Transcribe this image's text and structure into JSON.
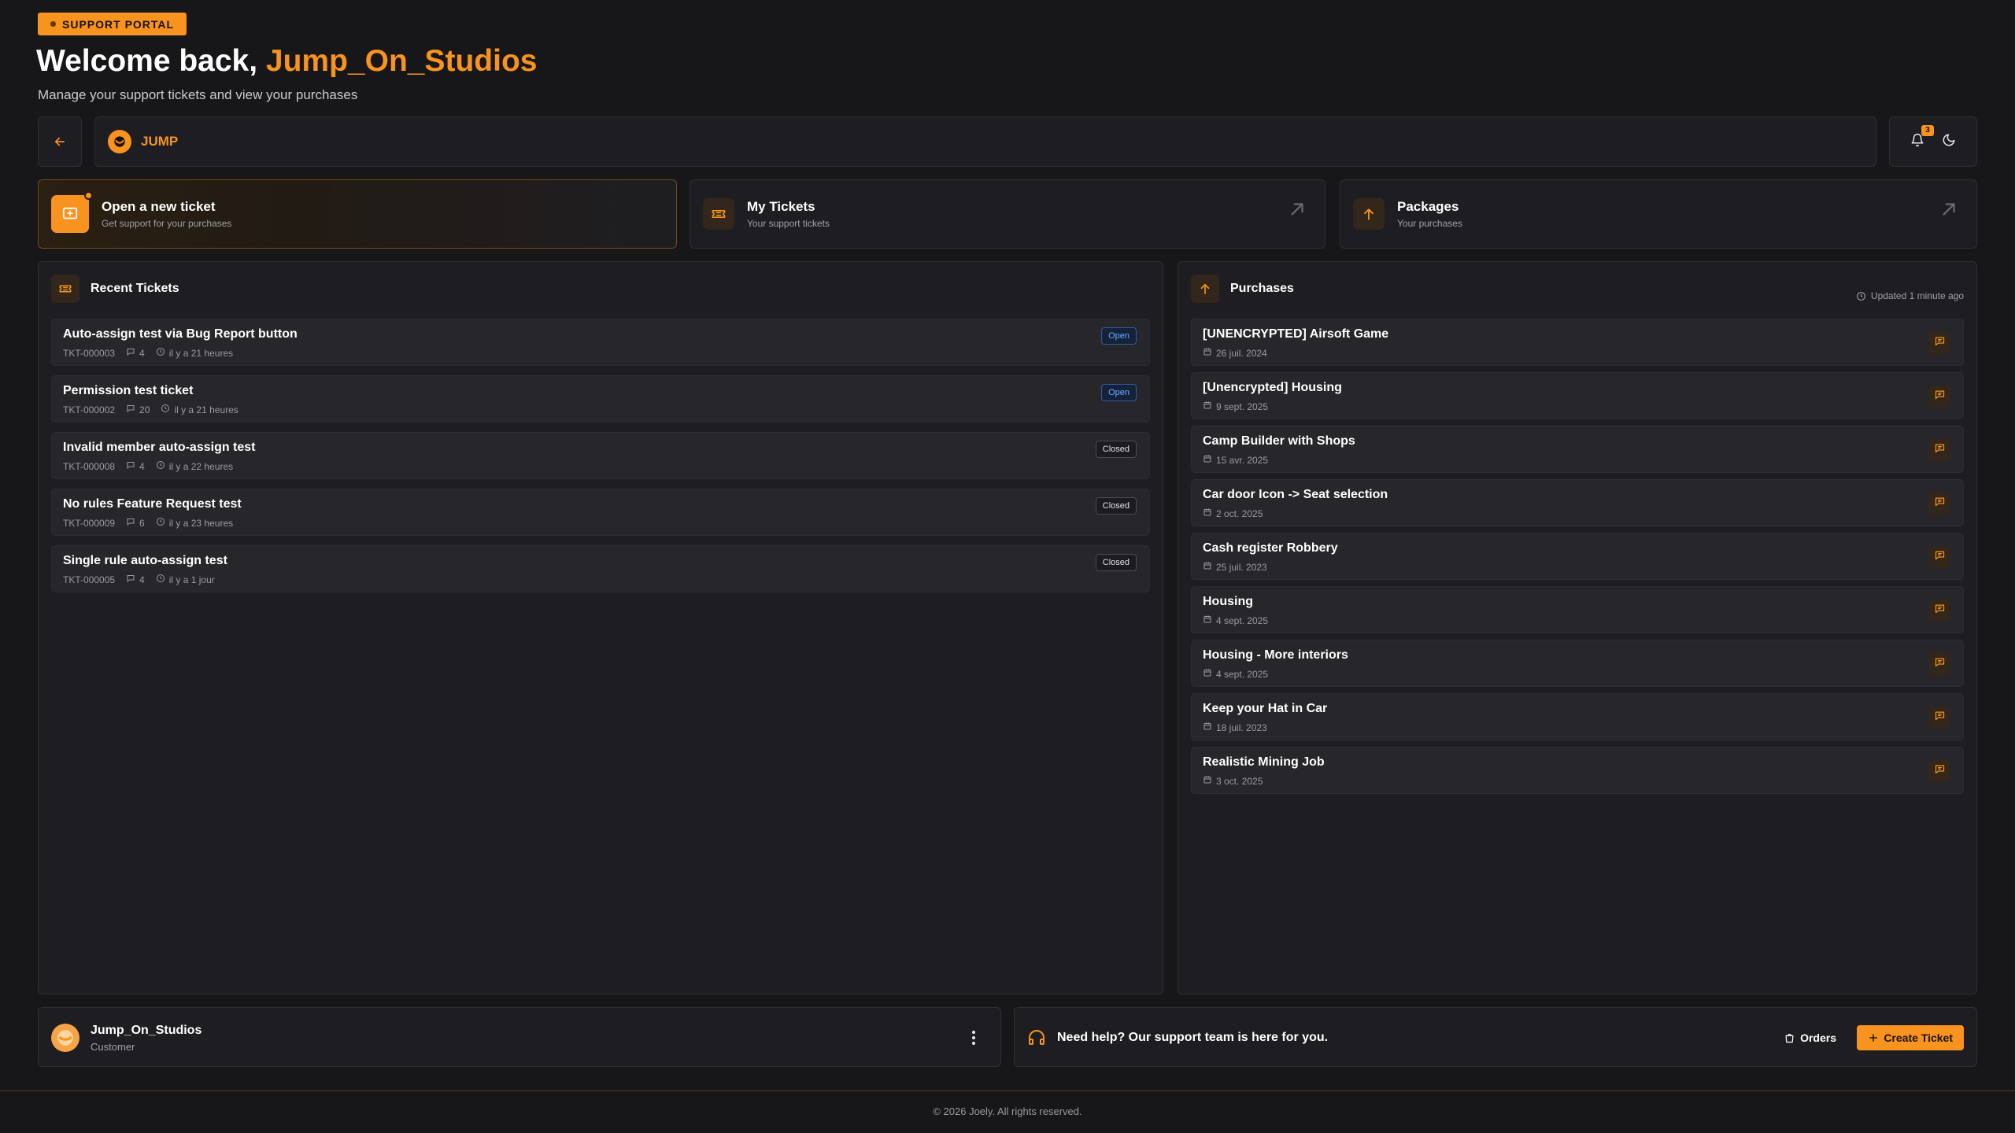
{
  "header": {
    "badge": "SUPPORT PORTAL",
    "welcome_prefix": "Welcome back,",
    "user_name": "Jump_On_Studios",
    "subtitle": "Manage your support tickets and view your purchases"
  },
  "brand": {
    "name": "JUMP"
  },
  "notifications": {
    "count": "3"
  },
  "quick_cards": [
    {
      "title": "Open a new ticket",
      "subtitle": "Get support for your purchases",
      "icon": "message-plus-icon"
    },
    {
      "title": "My Tickets",
      "subtitle": "Your support tickets",
      "icon": "ticket-icon"
    },
    {
      "title": "Packages",
      "subtitle": "Your purchases",
      "icon": "arrow-up-icon"
    }
  ],
  "tickets": {
    "title": "Recent Tickets",
    "items": [
      {
        "title": "Auto-assign test via Bug Report button",
        "id": "TKT-000003",
        "comments": "4",
        "time": "il y a 21 heures",
        "status": "Open"
      },
      {
        "title": "Permission test ticket",
        "id": "TKT-000002",
        "comments": "20",
        "time": "il y a 21 heures",
        "status": "Open"
      },
      {
        "title": "Invalid member auto-assign test",
        "id": "TKT-000008",
        "comments": "4",
        "time": "il y a 22 heures",
        "status": "Closed"
      },
      {
        "title": "No rules Feature Request test",
        "id": "TKT-000009",
        "comments": "6",
        "time": "il y a 23 heures",
        "status": "Closed"
      },
      {
        "title": "Single rule auto-assign test",
        "id": "TKT-000005",
        "comments": "4",
        "time": "il y a 1 jour",
        "status": "Closed"
      }
    ]
  },
  "purchases": {
    "title": "Purchases",
    "updated": "Updated 1 minute ago",
    "items": [
      {
        "title": "[UNENCRYPTED] Airsoft Game",
        "date": "26 juil. 2024"
      },
      {
        "title": "[Unencrypted] Housing",
        "date": "9 sept. 2025"
      },
      {
        "title": "Camp Builder with Shops",
        "date": "15 avr. 2025"
      },
      {
        "title": "Car door Icon -> Seat selection",
        "date": "2 oct. 2025"
      },
      {
        "title": "Cash register Robbery",
        "date": "25 juil. 2023"
      },
      {
        "title": "Housing",
        "date": "4 sept. 2025"
      },
      {
        "title": "Housing - More interiors",
        "date": "4 sept. 2025"
      },
      {
        "title": "Keep your Hat in Car",
        "date": "18 juil. 2023"
      },
      {
        "title": "Realistic Mining Job",
        "date": "3 oct. 2025"
      }
    ]
  },
  "user_card": {
    "name": "Jump_On_Studios",
    "role": "Customer"
  },
  "help": {
    "text": "Need help? Our support team is here for you.",
    "orders_label": "Orders",
    "create_label": "Create Ticket"
  },
  "footer": {
    "text": "© 2026 Joely. All rights reserved."
  },
  "colors": {
    "accent": "#f7931e",
    "background": "#17171a",
    "panel": "#1e1e22",
    "open": "#6ea8ff"
  }
}
